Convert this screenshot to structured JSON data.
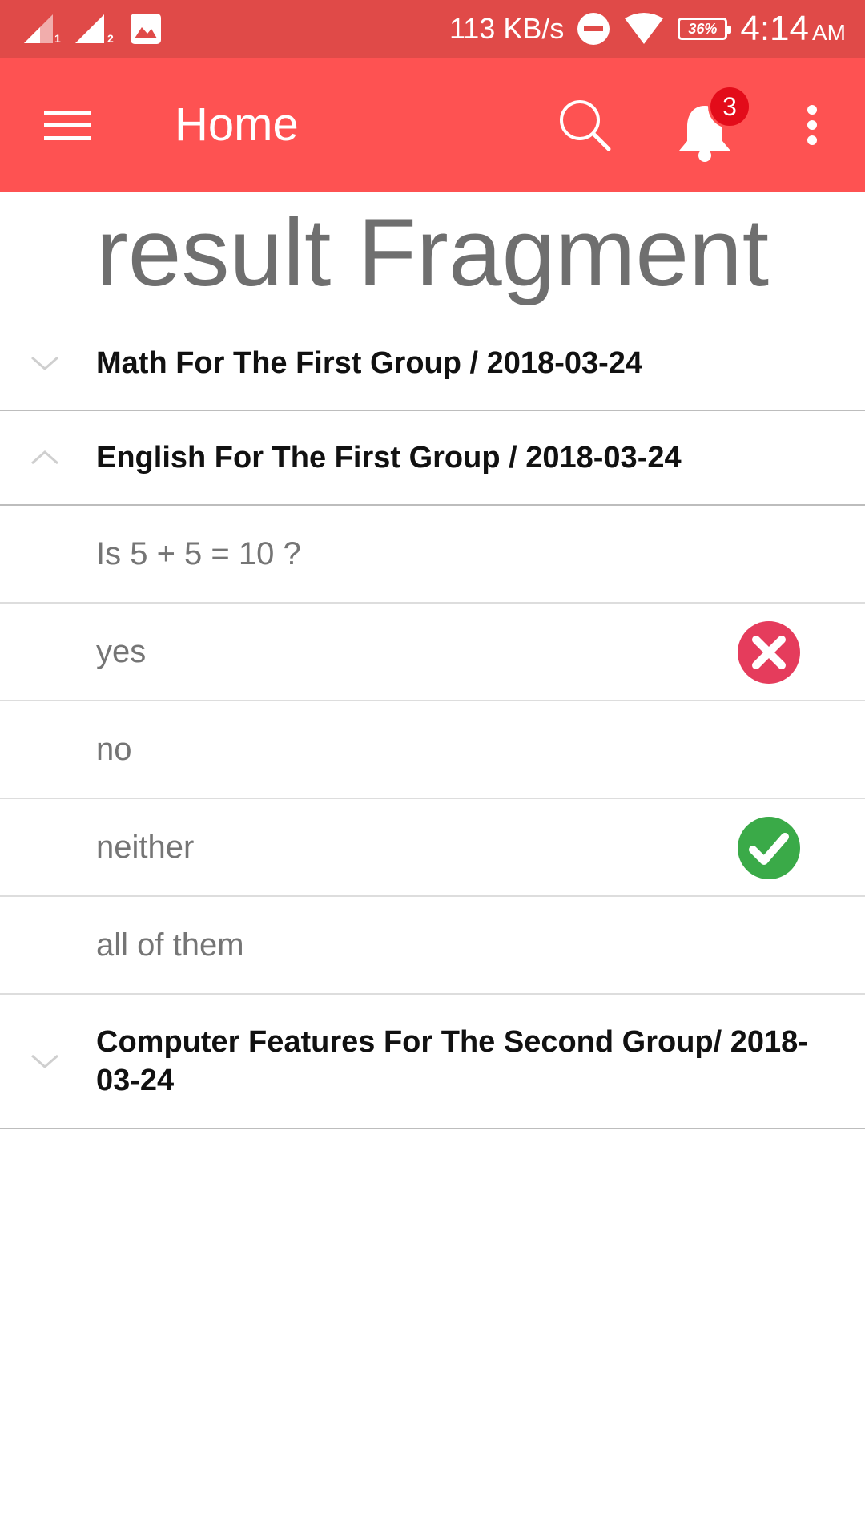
{
  "status_bar": {
    "sim1_label": "1",
    "sim2_label": "2",
    "speed": "113 KB/s",
    "battery": "36%",
    "time": "4:14",
    "ampm": "AM",
    "icons": [
      "signal-icon",
      "signal-icon",
      "gallery-icon",
      "dnd-icon",
      "wifi-icon",
      "battery-icon"
    ]
  },
  "app_bar": {
    "title": "Home",
    "notification_count": "3",
    "background_color": "#fe5252",
    "icons": [
      "menu-icon",
      "search-icon",
      "bell-icon",
      "more-vert-icon"
    ]
  },
  "heading": "result Fragment",
  "groups": [
    {
      "title": "Math For The First Group / 2018-03-24",
      "expanded": false,
      "chevron": "chevron-down-icon"
    },
    {
      "title": "English For The First Group / 2018-03-24",
      "expanded": true,
      "chevron": "chevron-up-icon",
      "question": "Is 5 + 5 = 10 ?",
      "answers": [
        {
          "text": "yes",
          "mark": "wrong-icon",
          "mark_color": "#e53c5c"
        },
        {
          "text": "no",
          "mark": ""
        },
        {
          "text": "neither",
          "mark": "correct-icon",
          "mark_color": "#3aaa48"
        },
        {
          "text": "all of them",
          "mark": ""
        }
      ]
    },
    {
      "title": "Computer Features For The Second Group/ 2018-03-24",
      "expanded": false,
      "chevron": "chevron-down-icon"
    }
  ]
}
